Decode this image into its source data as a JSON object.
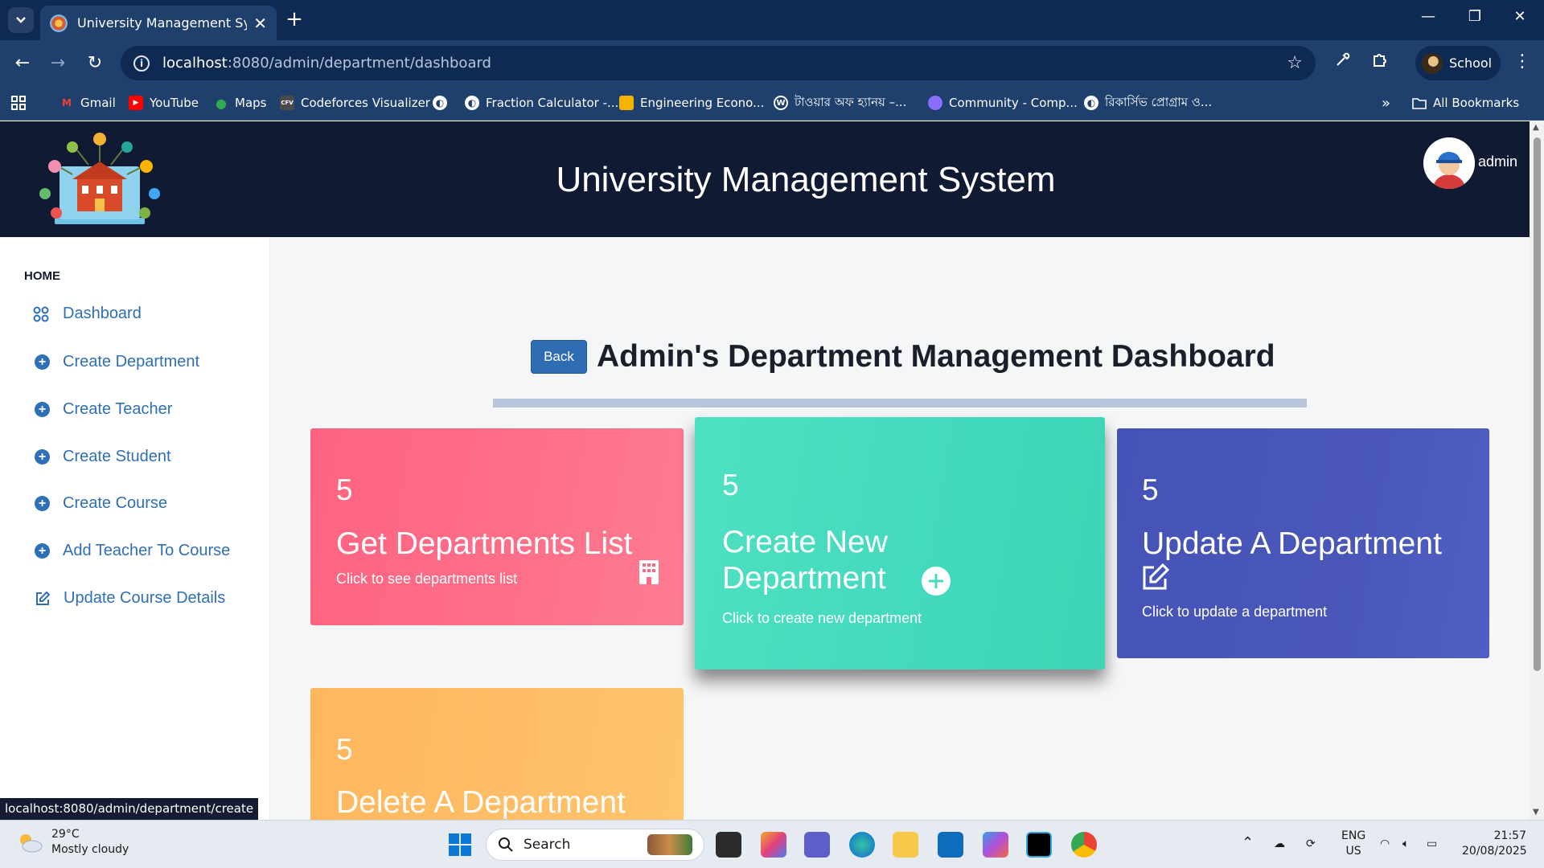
{
  "browser": {
    "tab_title": "University Management System",
    "url_host": "localhost",
    "url_path": ":8080/admin/department/dashboard",
    "profile_name": "School",
    "bookmarks": [
      {
        "label": "Gmail",
        "icon": "gmail-icon",
        "color": "#ea4335"
      },
      {
        "label": "YouTube",
        "icon": "youtube-icon",
        "color": "#ff0000"
      },
      {
        "label": "Maps",
        "icon": "maps-icon",
        "color": "#34a853"
      },
      {
        "label": "Codeforces Visualizer",
        "icon": "cfv-icon",
        "color": "#4a4a4a"
      },
      {
        "label": "",
        "icon": "globe-icon",
        "color": "#ffffff"
      },
      {
        "label": "Fraction Calculator -...",
        "icon": "globe-icon",
        "color": "#ffffff"
      },
      {
        "label": "Engineering Econo...",
        "icon": "slides-icon",
        "color": "#f4b400"
      },
      {
        "label": "টাওয়ার অফ হ্যানয় –...",
        "icon": "wordpress-icon",
        "color": "#ffffff"
      },
      {
        "label": "Community - Comp...",
        "icon": "community-icon",
        "color": "#8a6cff"
      },
      {
        "label": "রিকার্সিভ প্রোগ্রাম ও...",
        "icon": "globe-icon",
        "color": "#ffffff"
      }
    ],
    "all_bookmarks": "All Bookmarks",
    "status_url": "localhost:8080/admin/department/create"
  },
  "header": {
    "title": "University Management System",
    "user": "admin"
  },
  "sidebar": {
    "section": "HOME",
    "items": [
      {
        "label": "Dashboard",
        "icon": "dashboard-icon"
      },
      {
        "label": "Create Department",
        "icon": "plus-circle-icon"
      },
      {
        "label": "Create Teacher",
        "icon": "plus-circle-icon"
      },
      {
        "label": "Create Student",
        "icon": "plus-circle-icon"
      },
      {
        "label": "Create Course",
        "icon": "plus-circle-icon"
      },
      {
        "label": "Add Teacher To Course",
        "icon": "plus-circle-icon"
      },
      {
        "label": "Update Course Details",
        "icon": "edit-icon"
      }
    ]
  },
  "main": {
    "back_label": "Back",
    "title": "Admin's Department Management Dashboard",
    "cards": [
      {
        "count": "5",
        "title": "Get Departments List",
        "subtitle": "Click to see departments list",
        "icon": "building-icon",
        "color": "#fe6a86"
      },
      {
        "count": "5",
        "title_line1": "Create New",
        "title_line2": "Department",
        "subtitle": "Click to create new department",
        "icon": "plus-circle-icon",
        "color": "#46dbbf"
      },
      {
        "count": "5",
        "title": "Update A Department",
        "subtitle": "Click to update a department",
        "icon": "edit-icon",
        "color": "#4a57b9"
      },
      {
        "count": "5",
        "title": "Delete A Department",
        "subtitle": "",
        "icon": "",
        "color": "#ffbd66"
      }
    ]
  },
  "taskbar": {
    "temperature": "29°C",
    "weather": "Mostly cloudy",
    "search": "Search",
    "lang1": "ENG",
    "lang2": "US",
    "time": "21:57",
    "date": "20/08/2025"
  }
}
